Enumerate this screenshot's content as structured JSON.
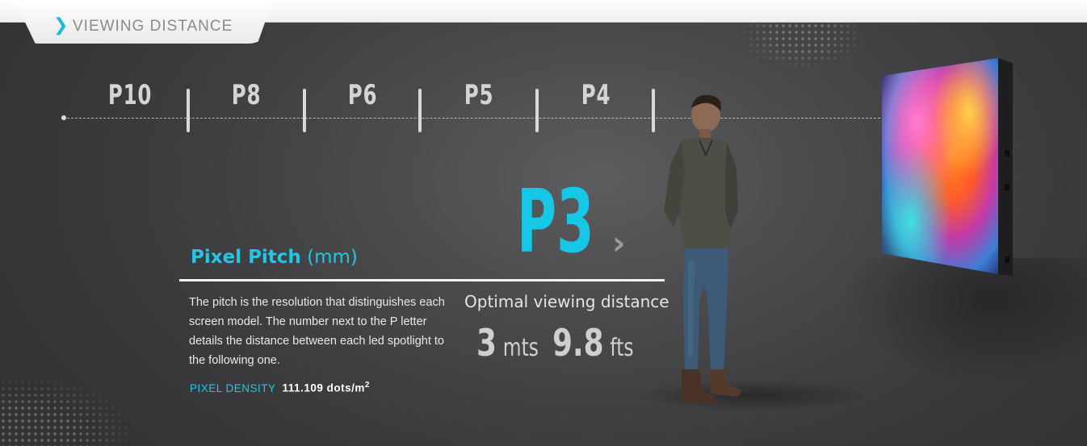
{
  "header": {
    "title": "VIEWING DISTANCE",
    "chevron_icon": "chevron-right-icon",
    "accent_color": "#19b9d8"
  },
  "scale": {
    "labels": [
      "P10",
      "P8",
      "P6",
      "P5",
      "P4"
    ]
  },
  "pixel_pitch": {
    "heading_strong": "Pixel Pitch",
    "heading_unit": "(mm)",
    "description": "The pitch is the resolution that distinguishes each screen model. The number next to the P letter details the distance between each led spotlight to the following one.",
    "density_label": "PIXEL DENSITY",
    "density_value": "111.109 dots/m",
    "density_exponent": "2"
  },
  "selected": {
    "model": "P3",
    "arrow_icon": "chevron-right-icon",
    "optimal_label": "Optimal viewing distance",
    "meters_value": "3",
    "meters_unit": "mts",
    "feet_value": "9.8",
    "feet_unit": "fts",
    "highlight_color": "#16c8e6"
  },
  "illustration": {
    "person": "standing-man",
    "screen": "led-screen-colorful-smoke"
  }
}
